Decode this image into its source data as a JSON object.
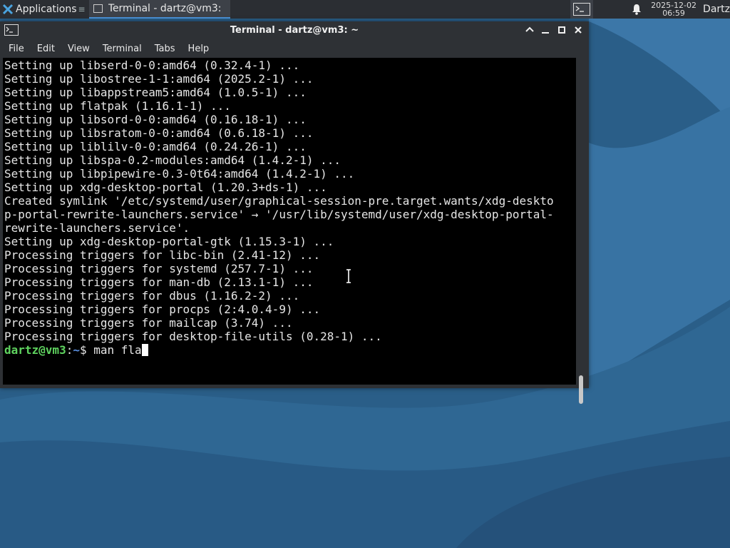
{
  "panel": {
    "apps_label": "Applications",
    "apps_more": "≡",
    "task_label": "Terminal - dartz@vm3: ~",
    "clock_date": "2025-12-02",
    "clock_time": "06:59",
    "user": "Dartz"
  },
  "window": {
    "title": "Terminal - dartz@vm3: ~",
    "menu": [
      "File",
      "Edit",
      "View",
      "Terminal",
      "Tabs",
      "Help"
    ]
  },
  "terminal": {
    "lines": [
      "Setting up libserd-0-0:amd64 (0.32.4-1) ...",
      "Setting up libostree-1-1:amd64 (2025.2-1) ...",
      "Setting up libappstream5:amd64 (1.0.5-1) ...",
      "Setting up flatpak (1.16.1-1) ...",
      "Setting up libsord-0-0:amd64 (0.16.18-1) ...",
      "Setting up libsratom-0-0:amd64 (0.6.18-1) ...",
      "Setting up liblilv-0-0:amd64 (0.24.26-1) ...",
      "Setting up libspa-0.2-modules:amd64 (1.4.2-1) ...",
      "Setting up libpipewire-0.3-0t64:amd64 (1.4.2-1) ...",
      "Setting up xdg-desktop-portal (1.20.3+ds-1) ...",
      "Created symlink '/etc/systemd/user/graphical-session-pre.target.wants/xdg-deskto",
      "p-portal-rewrite-launchers.service' → '/usr/lib/systemd/user/xdg-desktop-portal-",
      "rewrite-launchers.service'.",
      "Setting up xdg-desktop-portal-gtk (1.15.3-1) ...",
      "Processing triggers for libc-bin (2.41-12) ...",
      "Processing triggers for systemd (257.7-1) ...",
      "Processing triggers for man-db (2.13.1-1) ...",
      "Processing triggers for dbus (1.16.2-2) ...",
      "Processing triggers for procps (2:4.0.4-9) ...",
      "Processing triggers for mailcap (3.74) ...",
      "Processing triggers for desktop-file-utils (0.28-1) ..."
    ],
    "prompt_user": "dartz@vm3",
    "prompt_sep": ":",
    "prompt_path": "~",
    "prompt_symbol": "$ ",
    "command": "man fla"
  }
}
